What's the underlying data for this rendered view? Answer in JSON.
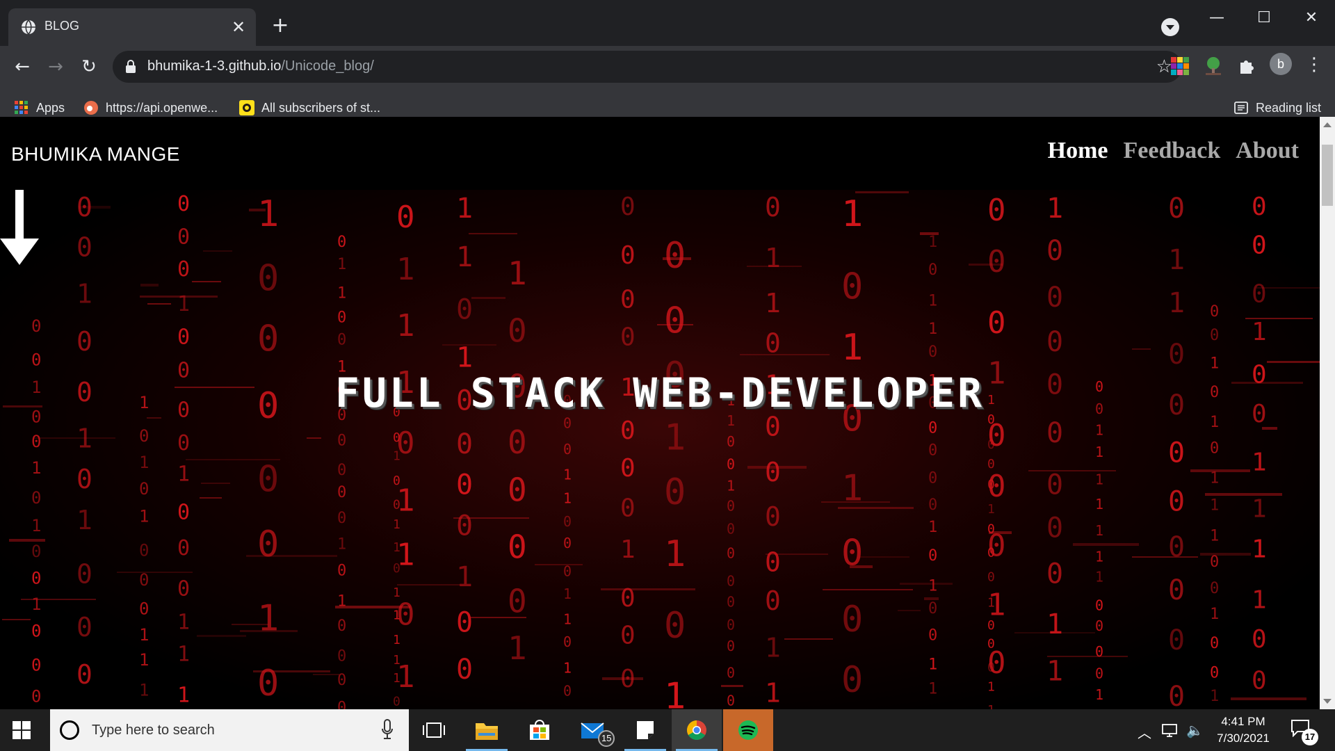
{
  "browser": {
    "tab_title": "BLOG",
    "tab_close": "✕",
    "new_tab": "+",
    "window_controls": {
      "minimize": "—",
      "maximize": "☐",
      "close": "✕"
    },
    "url_host": "bhumika-1-3.github.io",
    "url_path": "/Unicode_blog/",
    "profile_letter": "b",
    "bookmarks": [
      {
        "label": "Apps",
        "icon": "apps-grid-icon"
      },
      {
        "label": "https://api.openwe...",
        "icon": "openweather-icon"
      },
      {
        "label": "All subscribers of st...",
        "icon": "mailchimp-icon"
      }
    ],
    "reading_list": "Reading list"
  },
  "site": {
    "brand": "BHUMIKA MANGE",
    "nav": [
      {
        "label": "Home",
        "color": "#ffffff"
      },
      {
        "label": "Feedback",
        "color": "#a9a9a9"
      },
      {
        "label": "About",
        "color": "#a9a9a9"
      }
    ],
    "hero_title": "FULL STACK WEB-DEVELOPER",
    "accent_red": "#d4161b"
  },
  "taskbar": {
    "search_placeholder": "Type here to search",
    "mail_badge": "15",
    "time": "4:41 PM",
    "date": "7/30/2021",
    "notifications": "17"
  }
}
